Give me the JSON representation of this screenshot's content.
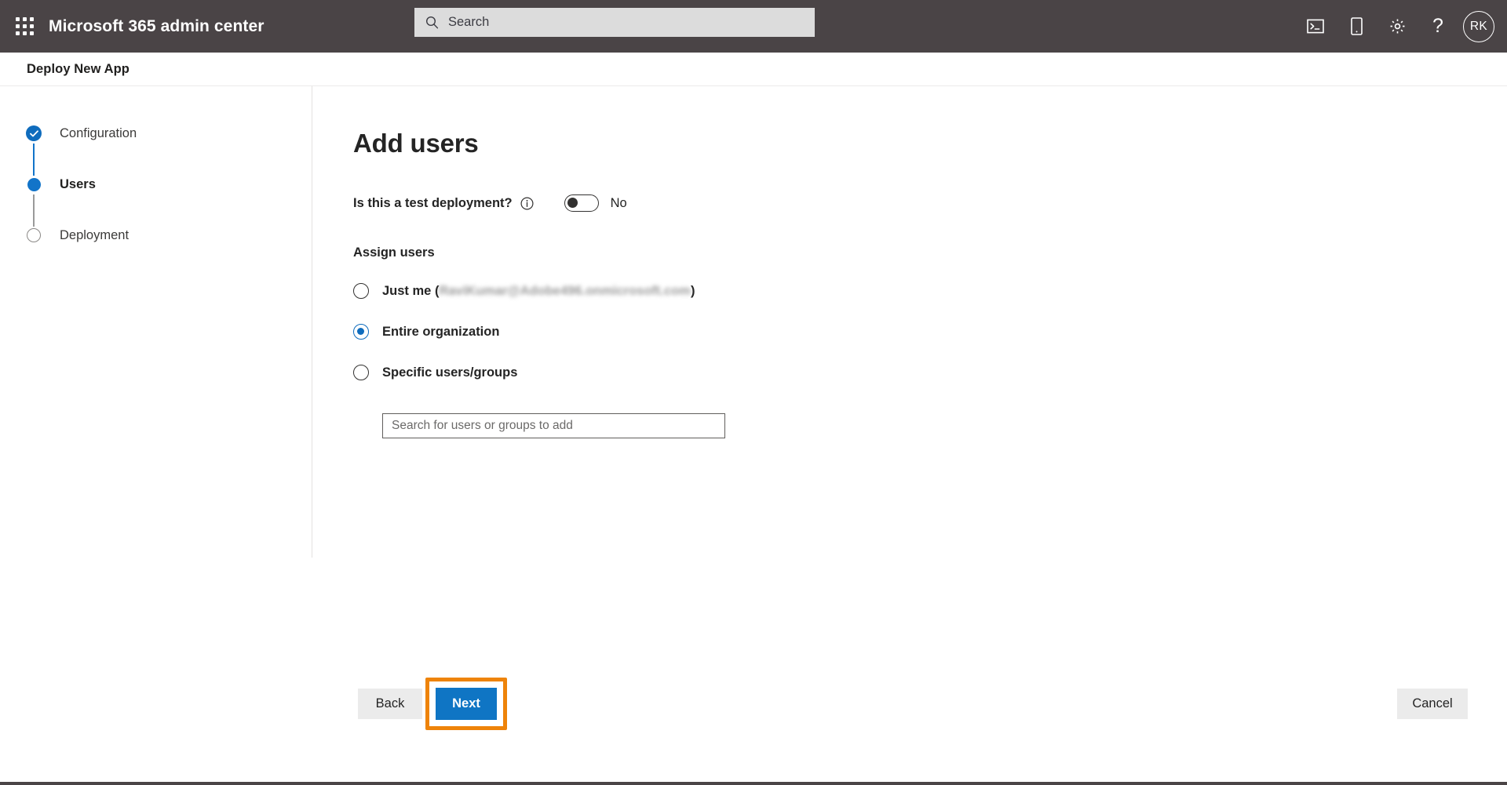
{
  "suitebar": {
    "waffle_label": "app-launcher",
    "title": "Microsoft 365 admin center",
    "search_placeholder": "Search",
    "search_value": "",
    "actions": [
      {
        "name": "cloud-shell-icon",
        "label": "Cloud Shell"
      },
      {
        "name": "mobile-device-icon",
        "label": "Mobile"
      },
      {
        "name": "gear-icon",
        "label": "Settings"
      },
      {
        "name": "help-icon",
        "label": "?"
      }
    ],
    "avatar_initials": "RK"
  },
  "page_header": {
    "title": "Deploy New App"
  },
  "wizard": {
    "steps": [
      {
        "label": "Configuration",
        "state": "completed"
      },
      {
        "label": "Users",
        "state": "current"
      },
      {
        "label": "Deployment",
        "state": "upcoming"
      }
    ]
  },
  "main": {
    "heading": "Add users",
    "test_deployment": {
      "label": "Is this a test deployment?",
      "info_icon": "info-icon",
      "toggle_state": "off",
      "toggle_value": "No"
    },
    "assign_users": {
      "label": "Assign users",
      "options": [
        {
          "id": "just-me",
          "label": "Just me (",
          "redacted_value": "RaviKumar@Adobe496.onmicrosoft.com",
          "suffix": ")",
          "selected": false
        },
        {
          "id": "entire-organization",
          "label": "Entire organization",
          "selected": true
        },
        {
          "id": "specific-users-groups",
          "label": "Specific users/groups",
          "selected": false
        }
      ],
      "search_placeholder": "Search for users or groups to add",
      "search_value": ""
    }
  },
  "footer": {
    "back_label": "Back",
    "next_label": "Next",
    "cancel_label": "Cancel"
  },
  "colors": {
    "suitebar_bg": "#4a4446",
    "accent_blue": "#0f6cbd",
    "primary_button": "#0f75c4",
    "highlight_orange": "#ee8309",
    "step_pending": "#8a8886"
  }
}
